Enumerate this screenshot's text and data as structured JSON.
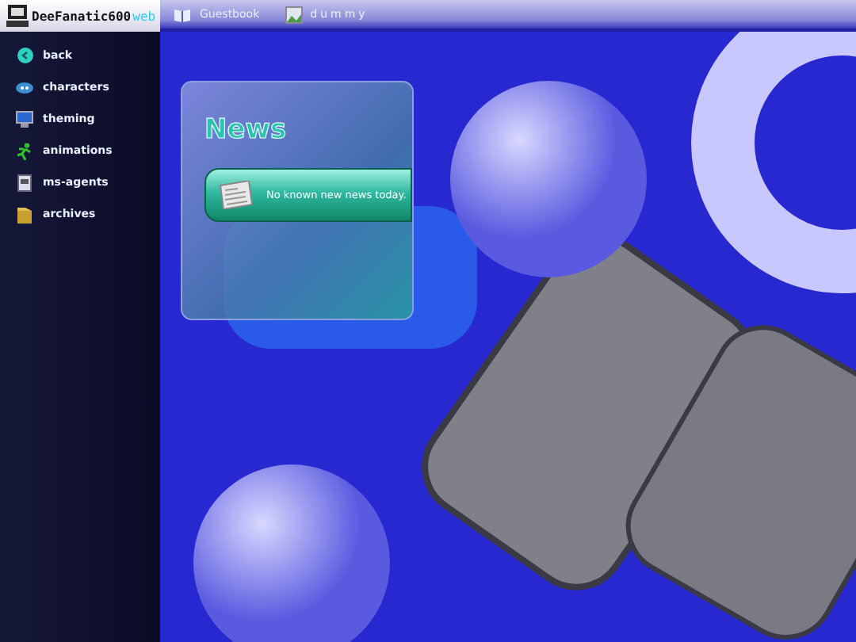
{
  "logo": {
    "name": "DeeFanatic600",
    "suffix": "web"
  },
  "top_links": [
    {
      "label": "Guestbook"
    },
    {
      "label": "dummy"
    }
  ],
  "sidebar": {
    "items": [
      {
        "label": "back"
      },
      {
        "label": "characters"
      },
      {
        "label": "theming"
      },
      {
        "label": "animations"
      },
      {
        "label": "ms-agents"
      },
      {
        "label": "archives"
      }
    ]
  },
  "news": {
    "title": "News",
    "items": [
      {
        "text": "No known new news today."
      }
    ]
  }
}
